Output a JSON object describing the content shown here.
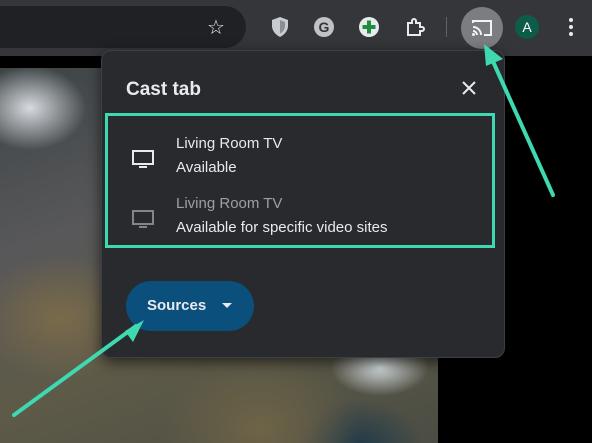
{
  "toolbar": {
    "star_glyph": "☆",
    "icons": [
      "bitwarden-shield-icon",
      "grammarly-icon",
      "green-plus-extension-icon",
      "extensions-puzzle-icon"
    ],
    "cast_icon": "cast-icon",
    "avatar_letter": "A",
    "avatar_color": "#0d5b49",
    "menu_icon": "more-vert-icon"
  },
  "cast_dialog": {
    "title": "Cast tab",
    "close_icon": "close-icon",
    "devices": [
      {
        "name": "Living Room TV",
        "status": "Available",
        "icon": "tv-icon",
        "enabled": true
      },
      {
        "name": "Living Room TV",
        "status": "Available for specific video sites",
        "icon": "tv-icon",
        "enabled": false
      }
    ],
    "sources_button": "Sources",
    "accent_color": "#0b4f7c"
  },
  "annotations": {
    "highlight_color": "#3ed8b1"
  }
}
